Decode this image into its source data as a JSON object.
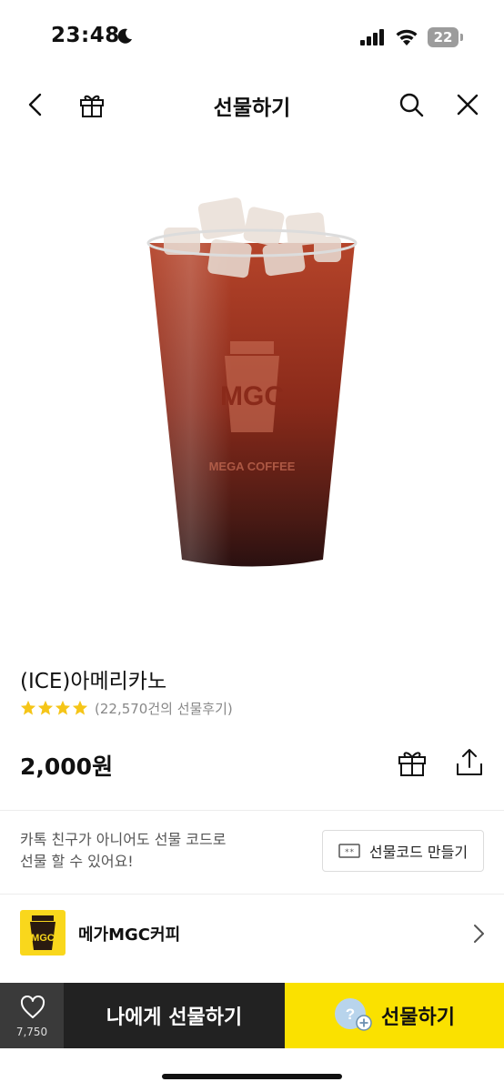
{
  "status_bar": {
    "time": "23:48",
    "battery": "22"
  },
  "nav": {
    "title": "선물하기",
    "icons": [
      "back-icon",
      "gift-box-icon",
      "search-icon",
      "close-icon"
    ]
  },
  "product": {
    "name": "(ICE)아메리카노",
    "rating": 4,
    "rating_max": 5,
    "review_count": "(22,570건의 선물후기)",
    "price": "2,000원",
    "cup_brand": "MEGA COFFEE",
    "cup_logo": "MGC"
  },
  "gift_code": {
    "text": "카톡 친구가 아니어도 선물 코드로\n선물 할 수 있어요!",
    "button_label": "선물코드 만들기"
  },
  "brand": {
    "name": "메가MGC커피",
    "logo": "MGC"
  },
  "bottom_bar": {
    "like_count": "7,750",
    "self_gift_label": "나에게 선물하기",
    "gift_label": "선물하기"
  },
  "colors": {
    "accent_yellow": "#fae100",
    "dark": "#222222",
    "star": "#f5c518"
  }
}
